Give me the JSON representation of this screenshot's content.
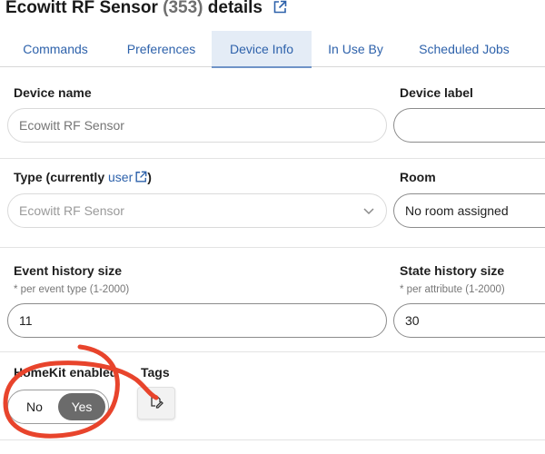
{
  "header": {
    "title_prefix": "Ecowitt RF Sensor",
    "device_id": "(353)",
    "title_suffix": "details",
    "external_link_icon": "external-link-icon"
  },
  "tabs": [
    {
      "label": "Commands",
      "active": false
    },
    {
      "label": "Preferences",
      "active": false
    },
    {
      "label": "Device Info",
      "active": true
    },
    {
      "label": "In Use By",
      "active": false
    },
    {
      "label": "Scheduled Jobs",
      "active": false
    }
  ],
  "device_name": {
    "label": "Device name",
    "placeholder": "Ecowitt RF Sensor",
    "value": ""
  },
  "device_label": {
    "label": "Device label",
    "value": ""
  },
  "type": {
    "label_prefix": "Type (currently",
    "link_text": "user",
    "label_suffix": ")",
    "value": "Ecowitt RF Sensor"
  },
  "room": {
    "label": "Room",
    "value": "No room assigned"
  },
  "event_history": {
    "label": "Event history size",
    "hint": "* per event type (1-2000)",
    "value": "11"
  },
  "state_history": {
    "label": "State history size",
    "hint": "* per attribute (1-2000)",
    "value": "30"
  },
  "homekit": {
    "label": "HomeKit enabled",
    "off_label": "No",
    "on_label": "Yes",
    "selected": "Yes"
  },
  "tags": {
    "label": "Tags",
    "icon": "edit-tag-icon"
  },
  "colors": {
    "link": "#2e62ab",
    "active_tab_bg": "#e4ecf6",
    "toggle_on": "#6b6b6b",
    "annotation": "#e8442c"
  }
}
